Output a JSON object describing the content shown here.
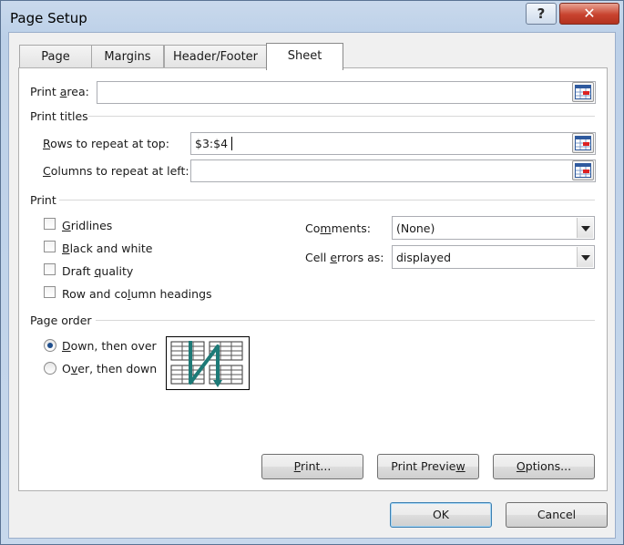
{
  "window": {
    "title": "Page Setup",
    "help": "?",
    "close": "✕"
  },
  "tabs": [
    {
      "label": "Page"
    },
    {
      "label": "Margins"
    },
    {
      "label": "Header/Footer"
    },
    {
      "label": "Sheet"
    }
  ],
  "print_area": {
    "label_pre": "Print ",
    "label_ul": "a",
    "label_post": "rea:",
    "value": ""
  },
  "print_titles": {
    "heading": "Print titles",
    "rows": {
      "label_ul": "R",
      "label_post": "ows to repeat at top:",
      "value": "$3:$4"
    },
    "cols": {
      "label_ul": "C",
      "label_post": "olumns to repeat at left:",
      "value": ""
    }
  },
  "print": {
    "heading": "Print",
    "gridlines": {
      "label_ul": "G",
      "label_post": "ridlines",
      "checked": false
    },
    "black_white": {
      "label_ul": "B",
      "label_post": "lack and white",
      "checked": false
    },
    "draft": {
      "label_pre": "Draft ",
      "label_ul": "q",
      "label_post": "uality",
      "checked": false
    },
    "headings": {
      "label_pre": "Row and co",
      "label_ul": "l",
      "label_post": "umn headings",
      "checked": false
    },
    "comments": {
      "label_pre": "Co",
      "label_ul": "m",
      "label_post": "ments:",
      "value": "(None)"
    },
    "cell_errors": {
      "label_pre": "Cell ",
      "label_ul": "e",
      "label_post": "rrors as:",
      "value": "displayed"
    }
  },
  "page_order": {
    "heading": "Page order",
    "down_over": {
      "label_ul": "D",
      "label_post": "own, then over",
      "selected": true
    },
    "over_down": {
      "label_pre": "O",
      "label_ul": "v",
      "label_post": "er, then down",
      "selected": false
    }
  },
  "buttons": {
    "print": {
      "label_ul": "P",
      "label_post": "rint..."
    },
    "preview": {
      "label_pre": "Print Previe",
      "label_ul": "w",
      "label_post": ""
    },
    "options": {
      "label_ul": "O",
      "label_post": "ptions..."
    },
    "ok": "OK",
    "cancel": "Cancel"
  },
  "colors": {
    "accent": "#3c7fb1",
    "close": "#c8432f",
    "arrow": "#1d7a77"
  }
}
